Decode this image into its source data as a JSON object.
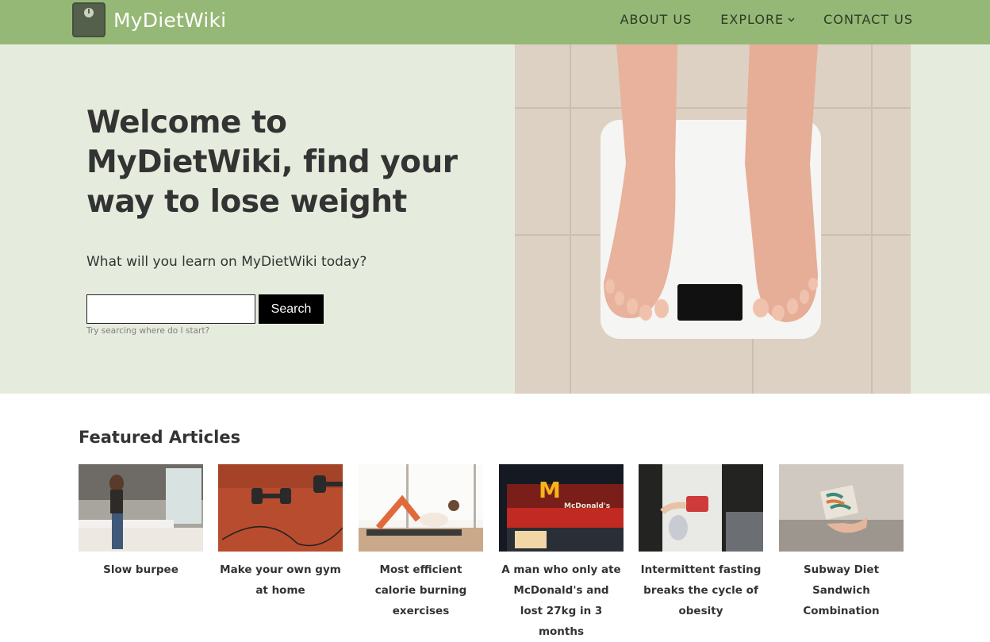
{
  "nav": {
    "brand": "MyDietWiki",
    "logo_icon": "scale-logo-icon",
    "links": [
      {
        "label": "ABOUT US"
      },
      {
        "label": "EXPLORE",
        "icon": "chevron-down-icon"
      },
      {
        "label": "CONTACT US"
      }
    ]
  },
  "hero": {
    "title": "Welcome to MyDietWiki, find your way to lose weight",
    "subtitle": "What will you learn on MyDietWiki today?",
    "search": {
      "value": "",
      "button_label": "Search",
      "hint": "Try searcing where do I start?"
    },
    "photo": "feet-on-bathroom-scale-photo"
  },
  "featured": {
    "title": "Featured Articles",
    "articles": [
      {
        "title": "Slow burpee",
        "thumb": "woman-in-kitchen-photo"
      },
      {
        "title": "Make your own gym at home",
        "thumb": "dumbbells-on-track-photo"
      },
      {
        "title": "Most efficient calorie burning exercises",
        "thumb": "woman-doing-crunches-photo"
      },
      {
        "title": "A man who only ate McDonald's and lost 27kg in 3 months",
        "thumb": "mcdonalds-storefront-photo"
      },
      {
        "title": "Intermittent fasting breaks the cycle of obesity",
        "thumb": "woman-with-shaker-photo"
      },
      {
        "title": "Subway Diet Sandwich Combination",
        "thumb": "hand-with-sandwich-photo"
      }
    ]
  },
  "colors": {
    "nav_bg": "#95b876",
    "hero_bg": "#e5ecdd",
    "text": "#333333",
    "button_bg": "#000000"
  }
}
